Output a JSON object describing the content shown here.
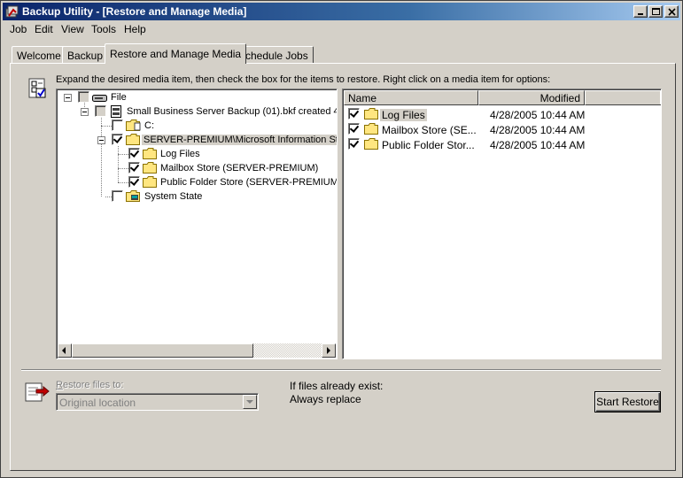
{
  "window": {
    "title": "Backup Utility - [Restore and Manage Media]",
    "controls": [
      "minimize-icon",
      "maximize-icon",
      "close-icon"
    ]
  },
  "menu": [
    "Job",
    "Edit",
    "View",
    "Tools",
    "Help"
  ],
  "tabs": [
    {
      "label": "Welcome",
      "active": false
    },
    {
      "label": "Backup",
      "active": false
    },
    {
      "label": "Restore and Manage Media",
      "active": true
    },
    {
      "label": "Schedule Jobs",
      "active": false
    }
  ],
  "instruction": "Expand the desired media item, then check the box for the items to restore. Right click on a media item for options:",
  "tree": {
    "root": "File",
    "backup": "Small Business Server Backup (01).bkf created 4/",
    "drive_c": "C:",
    "server_store": "SERVER-PREMIUM\\Microsoft Information Sto",
    "log_files": "Log Files",
    "mailbox_store": "Mailbox Store (SERVER-PREMIUM)",
    "public_folder": "Public Folder Store (SERVER-PREMIUM)",
    "system_state": "System State"
  },
  "list": {
    "columns": [
      "Name",
      "Modified"
    ],
    "rows": [
      {
        "name": "Log Files",
        "modified": "4/28/2005 10:44 AM",
        "checked": true,
        "selected": true
      },
      {
        "name": "Mailbox Store (SE...",
        "modified": "4/28/2005 10:44 AM",
        "checked": true,
        "selected": false
      },
      {
        "name": "Public Folder Stor...",
        "modified": "4/28/2005 10:44 AM",
        "checked": true,
        "selected": false
      }
    ]
  },
  "restore": {
    "label_prefix": "R",
    "label_rest": "estore files to:",
    "location": "Original location"
  },
  "existing": {
    "label": "If files already exist:",
    "value": "Always replace"
  },
  "start_button": "Start Restore",
  "colors": {
    "title_start": "#0a246a",
    "title_end": "#a6caf0",
    "face": "#d4d0c8",
    "check_blue": "#0000ff"
  }
}
